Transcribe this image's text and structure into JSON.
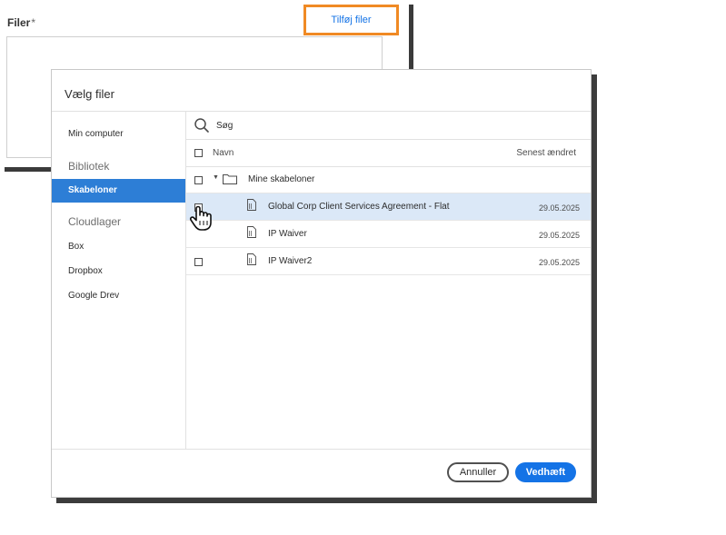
{
  "background": {
    "field_label": "Filer",
    "required_mark": "*",
    "add_files_link": "Tilføj filer",
    "highlight_color": "#f08a24"
  },
  "dialog": {
    "title": "Vælg filer",
    "sidebar": {
      "items": [
        {
          "label": "Min computer",
          "type": "item"
        },
        {
          "label": "Bibliotek",
          "type": "heading"
        },
        {
          "label": "Skabeloner",
          "type": "item",
          "active": true
        },
        {
          "label": "Cloudlager",
          "type": "heading"
        },
        {
          "label": "Box",
          "type": "item"
        },
        {
          "label": "Dropbox",
          "type": "item"
        },
        {
          "label": "Google Drev",
          "type": "item"
        }
      ]
    },
    "search": {
      "placeholder": "Søg",
      "icon": "search-icon"
    },
    "columns": {
      "name": "Navn",
      "modified": "Senest ændret"
    },
    "folder": {
      "name": "Mine skabeloner",
      "expanded": true
    },
    "files": [
      {
        "name": "Global Corp Client Services Agreement - Flat",
        "date": "29.05.2025",
        "selected": true,
        "checked": true
      },
      {
        "name": "IP Waiver",
        "date": "29.05.2025",
        "selected": false,
        "checked": false
      },
      {
        "name": "IP Waiver2",
        "date": "29.05.2025",
        "selected": false,
        "checked": false
      }
    ],
    "buttons": {
      "cancel": "Annuller",
      "attach": "Vedhæft"
    },
    "accent_color": "#1473e6",
    "active_item_color": "#2d7ed6",
    "selected_row_color": "#dbe8f7"
  }
}
